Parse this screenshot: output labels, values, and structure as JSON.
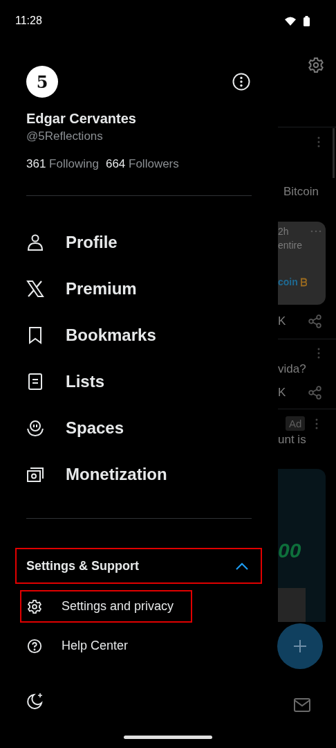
{
  "status_bar": {
    "time": "11:28"
  },
  "drawer": {
    "avatar_text": "5",
    "name": "Edgar Cervantes",
    "handle": "@5Reflections",
    "stats": [
      {
        "count": "361",
        "label": "Following"
      },
      {
        "count": "664",
        "label": "Followers"
      }
    ],
    "menu": [
      {
        "label": "Profile",
        "kind": "person"
      },
      {
        "label": "Premium",
        "kind": "x"
      },
      {
        "label": "Bookmarks",
        "kind": "bookmark"
      },
      {
        "label": "Lists",
        "kind": "list"
      },
      {
        "label": "Spaces",
        "kind": "spaces"
      },
      {
        "label": "Monetization",
        "kind": "money"
      }
    ],
    "settings_support": {
      "label": "Settings & Support",
      "expanded": true,
      "highlighted": true,
      "items": [
        {
          "label": "Settings and privacy",
          "kind": "gear",
          "highlighted": true
        },
        {
          "label": "Help Center",
          "kind": "help",
          "highlighted": false
        }
      ]
    }
  },
  "feed": {
    "post_1": {
      "text": "Bitcoin",
      "card_time": "2h",
      "card_text": "entire",
      "card_link": "coin",
      "count": "K"
    },
    "post_2": {
      "text": "vida?",
      "count": "K"
    },
    "post_3": {
      "badge": "Ad",
      "text": "unt is",
      "promo_text": "00"
    }
  }
}
